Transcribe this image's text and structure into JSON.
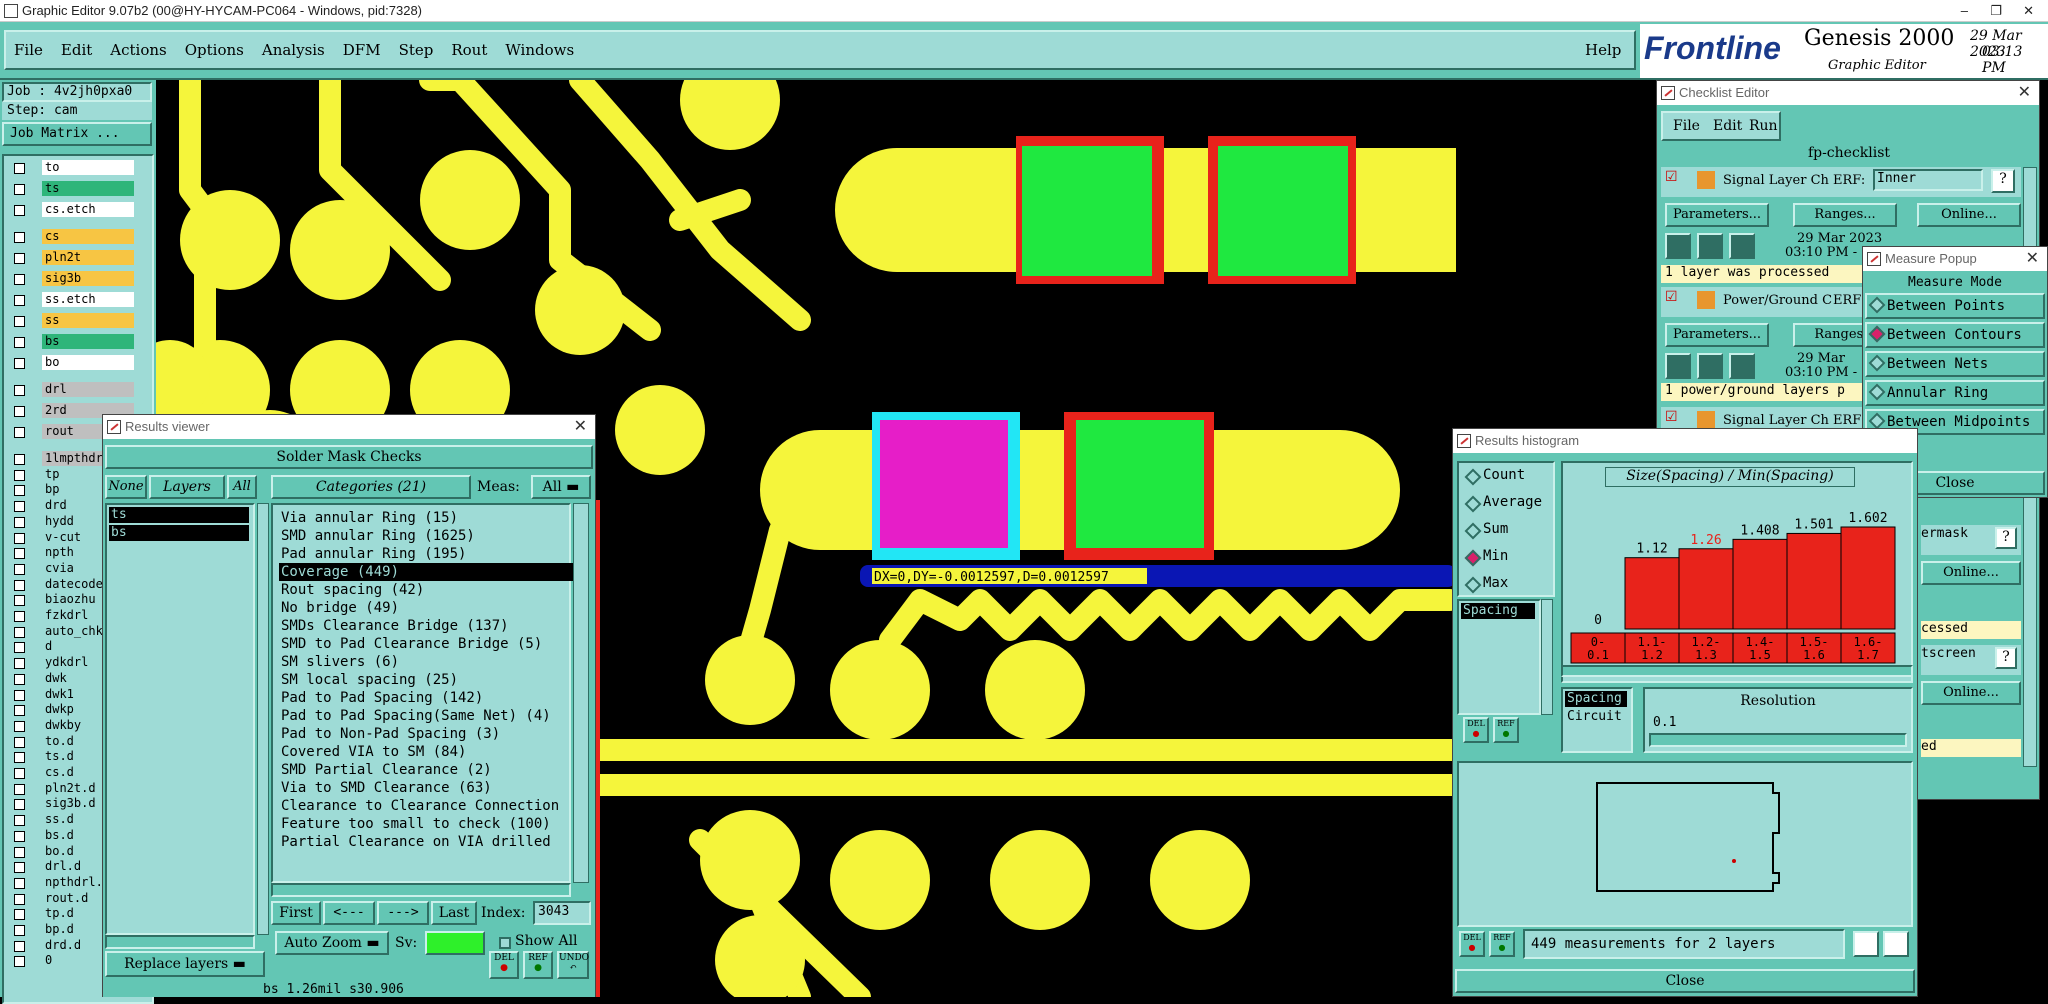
{
  "titlebar": {
    "title": "Graphic Editor 9.07b2 (00@HY-HYCAM-PC064 - Windows, pid:7328)"
  },
  "menubar": {
    "items": [
      "File",
      "Edit",
      "Actions",
      "Options",
      "Analysis",
      "DFM",
      "Step",
      "Rout",
      "Windows"
    ],
    "help": "Help"
  },
  "brand": {
    "logo": "Frontline",
    "product": "Genesis 2000",
    "date": "29 Mar 2023",
    "time": "03:13 PM",
    "subtitle": "Graphic Editor"
  },
  "job": {
    "job": "Job : 4v2jh0pxa0",
    "step": "Step: cam",
    "matrix_btn": "Job Matrix ..."
  },
  "layers": [
    {
      "name": "to",
      "color": "#ffffff"
    },
    {
      "name": "ts",
      "color": "#2eb57a"
    },
    {
      "name": "cs.etch",
      "color": "#ffffff"
    },
    {
      "name": "cs",
      "color": "#f7c543"
    },
    {
      "name": "pln2t",
      "color": "#f7c543"
    },
    {
      "name": "sig3b",
      "color": "#f7c543"
    },
    {
      "name": "ss.etch",
      "color": "#ffffff"
    },
    {
      "name": "ss",
      "color": "#f7c543"
    },
    {
      "name": "bs",
      "color": "#2eb57a"
    },
    {
      "name": "bo",
      "color": "#ffffff"
    },
    {
      "name": "drl",
      "color": "#bfbfbf"
    },
    {
      "name": "2rd",
      "color": "#bfbfbf"
    },
    {
      "name": "rout",
      "color": "#bfbfbf"
    },
    {
      "name": "1lmpthdrl",
      "color": "#bfbfbf"
    },
    {
      "name": "tp",
      "color": "#9edbd6"
    },
    {
      "name": "bp",
      "color": "#9edbd6"
    },
    {
      "name": "drd",
      "color": "#9edbd6"
    },
    {
      "name": "hydd",
      "color": "#9edbd6"
    },
    {
      "name": "v-cut",
      "color": "#9edbd6"
    },
    {
      "name": "npth",
      "color": "#9edbd6"
    },
    {
      "name": "cvia",
      "color": "#9edbd6"
    },
    {
      "name": "datecode",
      "color": "#9edbd6"
    },
    {
      "name": "biaozhu",
      "color": "#9edbd6"
    },
    {
      "name": "fzkdrl",
      "color": "#9edbd6"
    },
    {
      "name": "auto_chk",
      "color": "#9edbd6"
    },
    {
      "name": "d",
      "color": "#9edbd6"
    },
    {
      "name": "ydkdrl",
      "color": "#9edbd6"
    },
    {
      "name": "dwk",
      "color": "#9edbd6"
    },
    {
      "name": "dwk1",
      "color": "#9edbd6"
    },
    {
      "name": "dwkp",
      "color": "#9edbd6"
    },
    {
      "name": "dwkby",
      "color": "#9edbd6"
    },
    {
      "name": "to.d",
      "color": "#9edbd6"
    },
    {
      "name": "ts.d",
      "color": "#9edbd6"
    },
    {
      "name": "cs.d",
      "color": "#9edbd6"
    },
    {
      "name": "pln2t.d",
      "color": "#9edbd6"
    },
    {
      "name": "sig3b.d",
      "color": "#9edbd6"
    },
    {
      "name": "ss.d",
      "color": "#9edbd6"
    },
    {
      "name": "bs.d",
      "color": "#9edbd6"
    },
    {
      "name": "bo.d",
      "color": "#9edbd6"
    },
    {
      "name": "drl.d",
      "color": "#9edbd6"
    },
    {
      "name": "npthdrl.",
      "color": "#9edbd6"
    },
    {
      "name": "rout.d",
      "color": "#9edbd6"
    },
    {
      "name": "tp.d",
      "color": "#9edbd6"
    },
    {
      "name": "bp.d",
      "color": "#9edbd6"
    },
    {
      "name": "drd.d",
      "color": "#9edbd6"
    },
    {
      "name": "0",
      "color": "#9edbd6"
    }
  ],
  "canvas": {
    "measure_text": "DX=0,DY=-0.0012597,D=0.0012597"
  },
  "results_viewer": {
    "title": "Results viewer",
    "header": "Solder Mask Checks",
    "tabs": {
      "none": "None",
      "layers": "Layers",
      "all": "All",
      "categories": "Categories (21)",
      "meas": "Meas:",
      "meas_value": "All"
    },
    "layer_list": [
      "ts",
      "bs"
    ],
    "categories": [
      "Via annular Ring (15)",
      "SMD annular Ring (1625)",
      "Pad annular Ring (195)",
      "Coverage (449)",
      "Rout spacing (42)",
      "No bridge (49)",
      "SMDs Clearance Bridge (137)",
      "SMD to Pad Clearance Bridge (5)",
      "SM slivers (6)",
      "SM local spacing (25)",
      "Pad to Pad Spacing (142)",
      "Pad to Pad Spacing(Same Net) (4)",
      "Pad to Non-Pad Spacing (3)",
      "Covered VIA to SM (84)",
      "SMD Partial Clearance (2)",
      "Via to SMD Clearance (63)",
      "Clearance to Clearance Connection",
      "Feature too small to check (100)",
      "Partial Clearance on VIA drilled"
    ],
    "selected_index": 3,
    "nav": {
      "first": "First",
      "prev": "<---",
      "next": "--->",
      "last": "Last",
      "index_label": "Index:",
      "index_value": "3043"
    },
    "auto_zoom": "Auto Zoom",
    "sv": "Sv:",
    "show_all": "Show All",
    "replace": "Replace layers",
    "del": "DEL",
    "ref": "REF",
    "undo": "UNDO",
    "status": "bs 1.26mil s30.906"
  },
  "checklist": {
    "title": "Checklist Editor",
    "menu": [
      "File",
      "Edit",
      "Run"
    ],
    "name": "fp-checklist",
    "rows": [
      {
        "label": "Signal Layer Ch",
        "erf": "ERF:",
        "erf_value": "Inner",
        "date": "29 Mar 2023",
        "time": "03:10 PM -",
        "msg": "1 layer was processed"
      },
      {
        "label": "Power/Ground C",
        "erf": "ERF:",
        "date": "29 Mar",
        "time": "03:10 PM -",
        "msg": "1 power/ground layers p"
      },
      {
        "label": "Signal Layer Ch",
        "erf": "ERF:"
      }
    ],
    "params": "Parameters...",
    "ranges": "Ranges...",
    "online": "Online...",
    "partial": [
      "ermask",
      "Online...",
      "cessed",
      "tscreen",
      "Online...",
      "ed"
    ]
  },
  "measure": {
    "title": "Measure Popup",
    "mode": "Measure Mode",
    "options": [
      "Between Points",
      "Between Contours",
      "Between Nets",
      "Annular Ring",
      "Between Midpoints"
    ],
    "selected": 1,
    "close": "Close"
  },
  "histogram": {
    "title": "Results histogram",
    "modes": [
      "Count",
      "Average",
      "Sum",
      "Min",
      "Max"
    ],
    "selected": 3,
    "list": [
      "Spacing"
    ],
    "chart_title": "Size(Spacing) / Min(Spacing)",
    "chart_data": {
      "type": "bar",
      "categories": [
        "0-\n0.1",
        "1.1-\n1.2",
        "1.2-\n1.3",
        "1.4-\n1.5",
        "1.5-\n1.6",
        "1.6-\n1.7"
      ],
      "values": [
        0,
        1.12,
        1.26,
        1.408,
        1.501,
        1.602
      ],
      "labels": [
        "0",
        "1.12",
        "1.26",
        "1.408",
        "1.501",
        "1.602"
      ],
      "highlight": 2
    },
    "attrs": [
      "Spacing",
      "Circuit"
    ],
    "resolution_label": "Resolution",
    "resolution": "0.1",
    "summary": "449 measurements for 2 layers",
    "close": "Close",
    "del": "DEL",
    "ref": "REF"
  },
  "colors": {
    "teal": "#63c6b4",
    "light": "#9edbd6",
    "pad": "#f5f53b",
    "copper": "#f5f53b",
    "mask": "#e8231b",
    "green": "#1fe840",
    "magenta": "#e61ec8",
    "cyan": "#22e6f5"
  }
}
